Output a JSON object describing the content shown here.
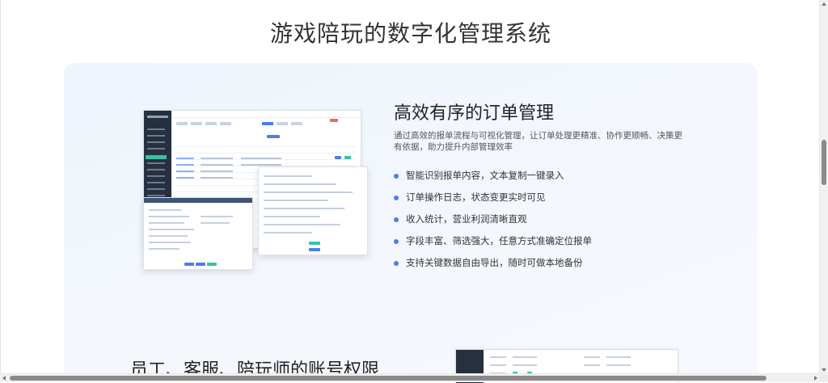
{
  "page": {
    "title": "游戏陪玩的数字化管理系统"
  },
  "section_orders": {
    "title": "高效有序的订单管理",
    "description": "通过高效的报单流程与可视化管理，让订单处理更精准、协作更顺畅、决策更有依据，助力提升内部管理效率",
    "features": [
      "智能识别报单内容，文本复制一键录入",
      "订单操作日志，状态变更实时可见",
      "收入统计，营业利润清晰直观",
      "字段丰富、筛选强大，任意方式准确定位报单",
      "支持关键数据自由导出，随时可做本地备份"
    ]
  },
  "section_accounts": {
    "title": "员工、客服、陪玩师的账号权限"
  },
  "icons": {
    "feature_bullet": "dot-icon",
    "scroll_up": "arrow-up-icon",
    "scroll_down": "arrow-down-icon",
    "scroll_left": "arrow-left-icon",
    "scroll_right": "arrow-right-icon"
  },
  "colors": {
    "accent": "#4a7df0",
    "sidebar_dark": "#27303f",
    "teal": "#36c2a6",
    "panel_bg": "#eef4fc"
  }
}
